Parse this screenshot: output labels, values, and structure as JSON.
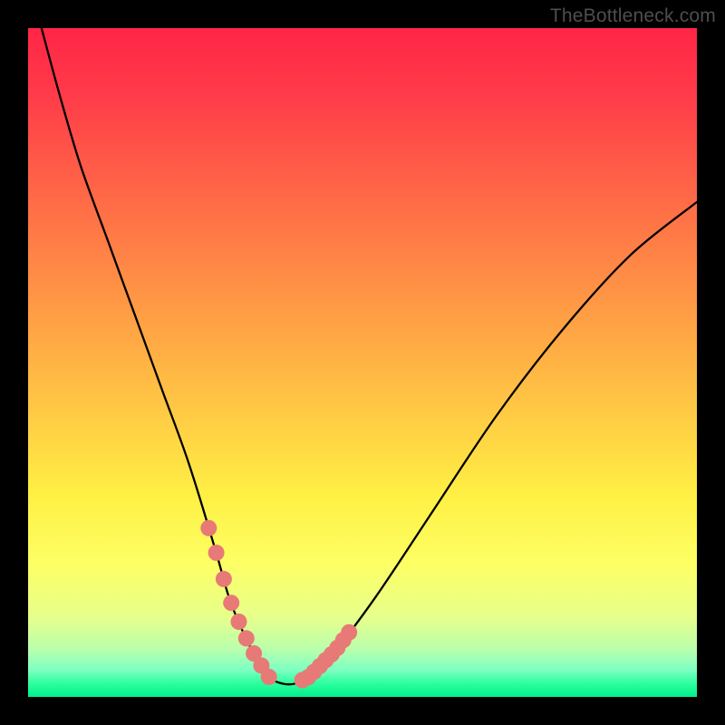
{
  "watermark": "TheBottleneck.com",
  "chart_data": {
    "type": "line",
    "title": "",
    "xlabel": "",
    "ylabel": "",
    "xlim": [
      0,
      100
    ],
    "ylim": [
      0,
      100
    ],
    "series": [
      {
        "name": "bottleneck-curve",
        "x": [
          2,
          5,
          8,
          12,
          16,
          20,
          24,
          28,
          30,
          32,
          34,
          36,
          38,
          40,
          42,
          46,
          52,
          60,
          70,
          80,
          90,
          100
        ],
        "y": [
          100,
          89,
          79,
          68,
          57,
          46,
          35,
          22,
          15,
          10,
          6,
          3,
          2,
          2,
          3,
          7,
          15,
          27,
          42,
          55,
          66,
          74
        ]
      }
    ],
    "highlight_segments": [
      {
        "name": "left-bottom-band",
        "x_range": [
          27,
          36
        ]
      },
      {
        "name": "right-bottom-band",
        "x_range": [
          41,
          48
        ]
      }
    ],
    "colors": {
      "curve": "#000000",
      "highlight": "#e77a76",
      "gradient_top": "#ff2546",
      "gradient_bottom": "#00f08c"
    }
  }
}
